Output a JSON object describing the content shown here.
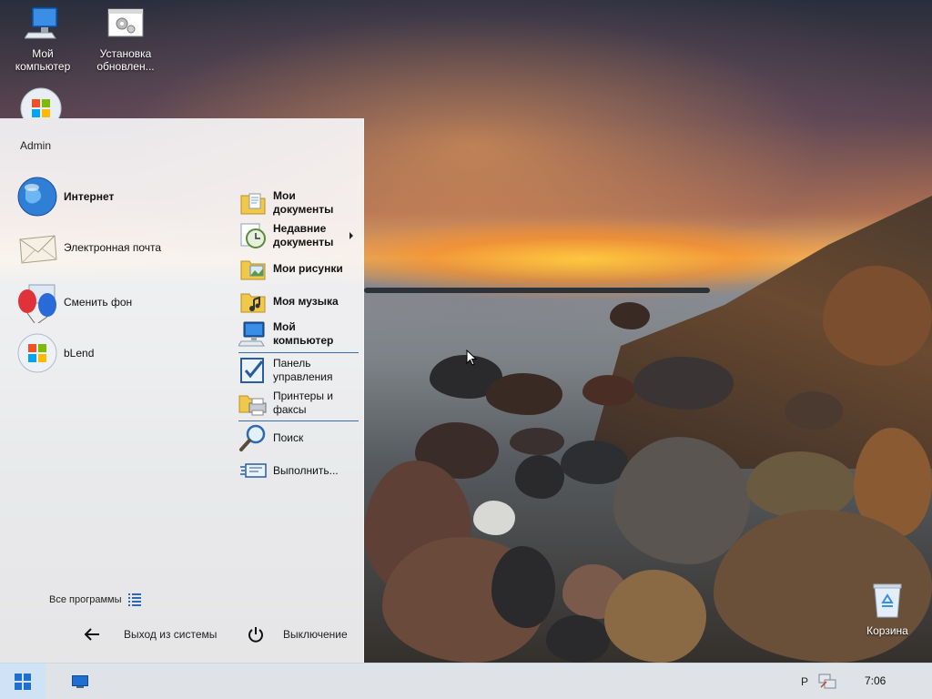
{
  "desktop": {
    "icons": [
      {
        "label": "Мой\nкомпьютер"
      },
      {
        "label": "Установка\nобновлен..."
      },
      {
        "label": "Корзина"
      }
    ]
  },
  "start_menu": {
    "user": "Admin",
    "left_items": [
      {
        "label": "Интернет"
      },
      {
        "label": "Электронная почта"
      },
      {
        "label": "Сменить фон"
      },
      {
        "label": "bLend"
      }
    ],
    "right_items": [
      {
        "label": "Мои документы"
      },
      {
        "label": "Недавние документы"
      },
      {
        "label": "Мои рисунки"
      },
      {
        "label": "Моя музыка"
      },
      {
        "label": "Мой компьютер"
      },
      {
        "label": "Панель управления"
      },
      {
        "label": "Принтеры и факсы"
      },
      {
        "label": "Поиск"
      },
      {
        "label": "Выполнить..."
      }
    ],
    "all_programs": "Все программы",
    "logout": "Выход из системы",
    "shutdown": "Выключение"
  },
  "taskbar": {
    "language": "Р",
    "clock": "7:06"
  },
  "colors": {
    "accent": "#3c6ea8",
    "start_button_bg": "#cfe2f6",
    "taskbar_bg": "#e8ecf0"
  }
}
